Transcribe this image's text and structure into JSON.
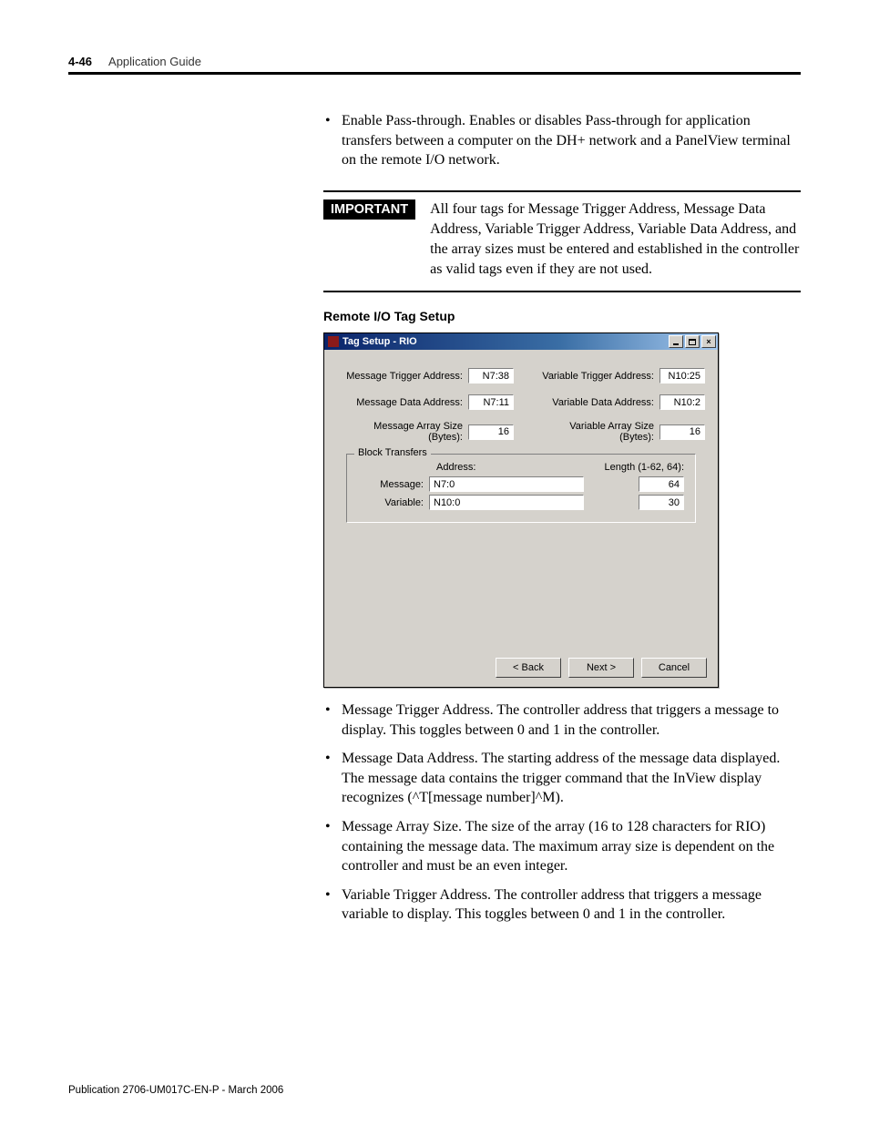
{
  "header": {
    "page_number": "4-46",
    "title": "Application Guide"
  },
  "intro_bullets": [
    "Enable Pass-through. Enables or disables Pass-through for application transfers between a computer on the DH+ network and a PanelView terminal on the remote I/O network."
  ],
  "important": {
    "label": "IMPORTANT",
    "text": "All four tags for Message Trigger Address, Message Data Address, Variable Trigger Address, Variable Data Address, and the array sizes must be entered and established in the controller as valid tags even if they are not used."
  },
  "section_heading": "Remote I/O Tag Setup",
  "dialog": {
    "title": "Tag Setup - RIO",
    "fields_left": [
      {
        "label": "Message Trigger Address:",
        "value": "N7:38"
      },
      {
        "label": "Message Data Address:",
        "value": "N7:11"
      },
      {
        "label": "Message Array Size (Bytes):",
        "value": "16"
      }
    ],
    "fields_right": [
      {
        "label": "Variable Trigger Address:",
        "value": "N10:25"
      },
      {
        "label": "Variable Data Address:",
        "value": "N10:2"
      },
      {
        "label": "Variable Array Size (Bytes):",
        "value": "16"
      }
    ],
    "block_transfers": {
      "legend": "Block Transfers",
      "col_address": "Address:",
      "col_length": "Length (1-62, 64):",
      "rows": [
        {
          "label": "Message:",
          "address": "N7:0",
          "length": "64"
        },
        {
          "label": "Variable:",
          "address": "N10:0",
          "length": "30"
        }
      ]
    },
    "buttons": {
      "back": "< Back",
      "next": "Next >",
      "cancel": "Cancel"
    }
  },
  "post_bullets": [
    "Message Trigger Address. The controller address that triggers a message to display. This toggles between 0 and 1 in the controller.",
    "Message Data Address. The starting address of the message data displayed. The message data contains the trigger command that the InView display recognizes (^T[message number]^M).",
    "Message Array Size. The size of the array (16 to 128 characters for RIO) containing the message data. The maximum array size is dependent on the controller and must be an even integer.",
    "Variable Trigger Address. The controller address that triggers a message variable to display. This toggles between 0 and 1 in the controller."
  ],
  "footer": "Publication 2706-UM017C-EN-P - March 2006"
}
